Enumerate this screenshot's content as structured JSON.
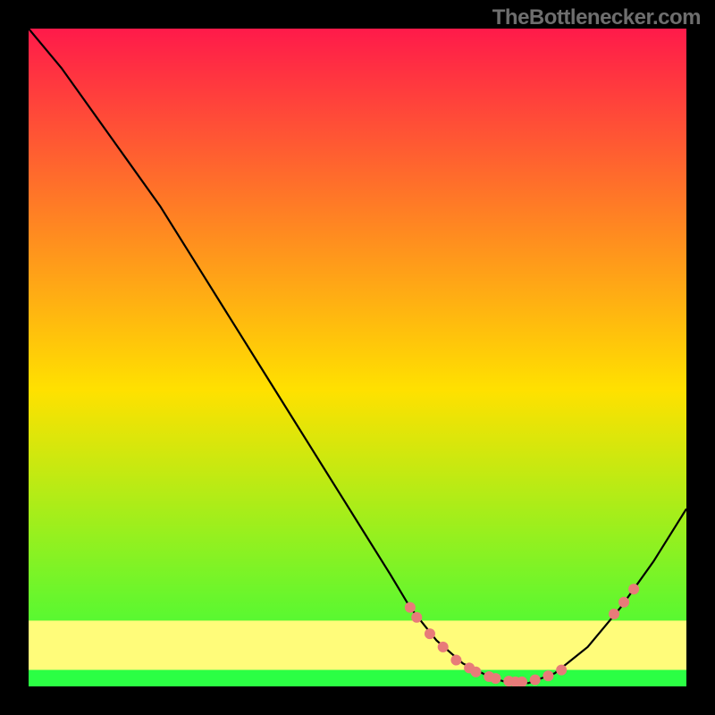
{
  "watermark": "TheBottlenecker.com",
  "chart_data": {
    "type": "line",
    "title": "",
    "xlabel": "",
    "ylabel": "",
    "xlim": [
      0,
      100
    ],
    "ylim": [
      0,
      100
    ],
    "grid": false,
    "series": [
      {
        "name": "curve",
        "x": [
          0,
          5,
          10,
          15,
          20,
          25,
          30,
          35,
          40,
          45,
          50,
          55,
          58,
          62,
          66,
          70,
          73,
          76,
          80,
          85,
          90,
          95,
          100
        ],
        "y": [
          100,
          94,
          87,
          80,
          73,
          65,
          57,
          49,
          41,
          33,
          25,
          17,
          12,
          7,
          3.5,
          1.5,
          0.5,
          0.5,
          2,
          6,
          12,
          19,
          27
        ]
      }
    ],
    "scatter": [
      {
        "name": "dots",
        "x": [
          58,
          59,
          61,
          63,
          65,
          67,
          68,
          70,
          71,
          73,
          74,
          75,
          77,
          79,
          81,
          89,
          90.5,
          92
        ],
        "y": [
          12,
          10.5,
          8,
          6,
          4,
          2.8,
          2.2,
          1.5,
          1.2,
          0.8,
          0.7,
          0.7,
          1,
          1.6,
          2.5,
          11,
          12.8,
          14.8
        ]
      }
    ],
    "bands": {
      "green_y": [
        0,
        2.5
      ],
      "yellowband_y": [
        2.5,
        10
      ]
    },
    "colors": {
      "dot": "#e87b79",
      "curve": "#000000",
      "gradient_top": "#ff1a4a",
      "gradient_mid": "#ffe100",
      "gradient_bottom": "#29ff3f",
      "green_band": "#2bff44",
      "yellow_band": "#fffc7a"
    }
  }
}
